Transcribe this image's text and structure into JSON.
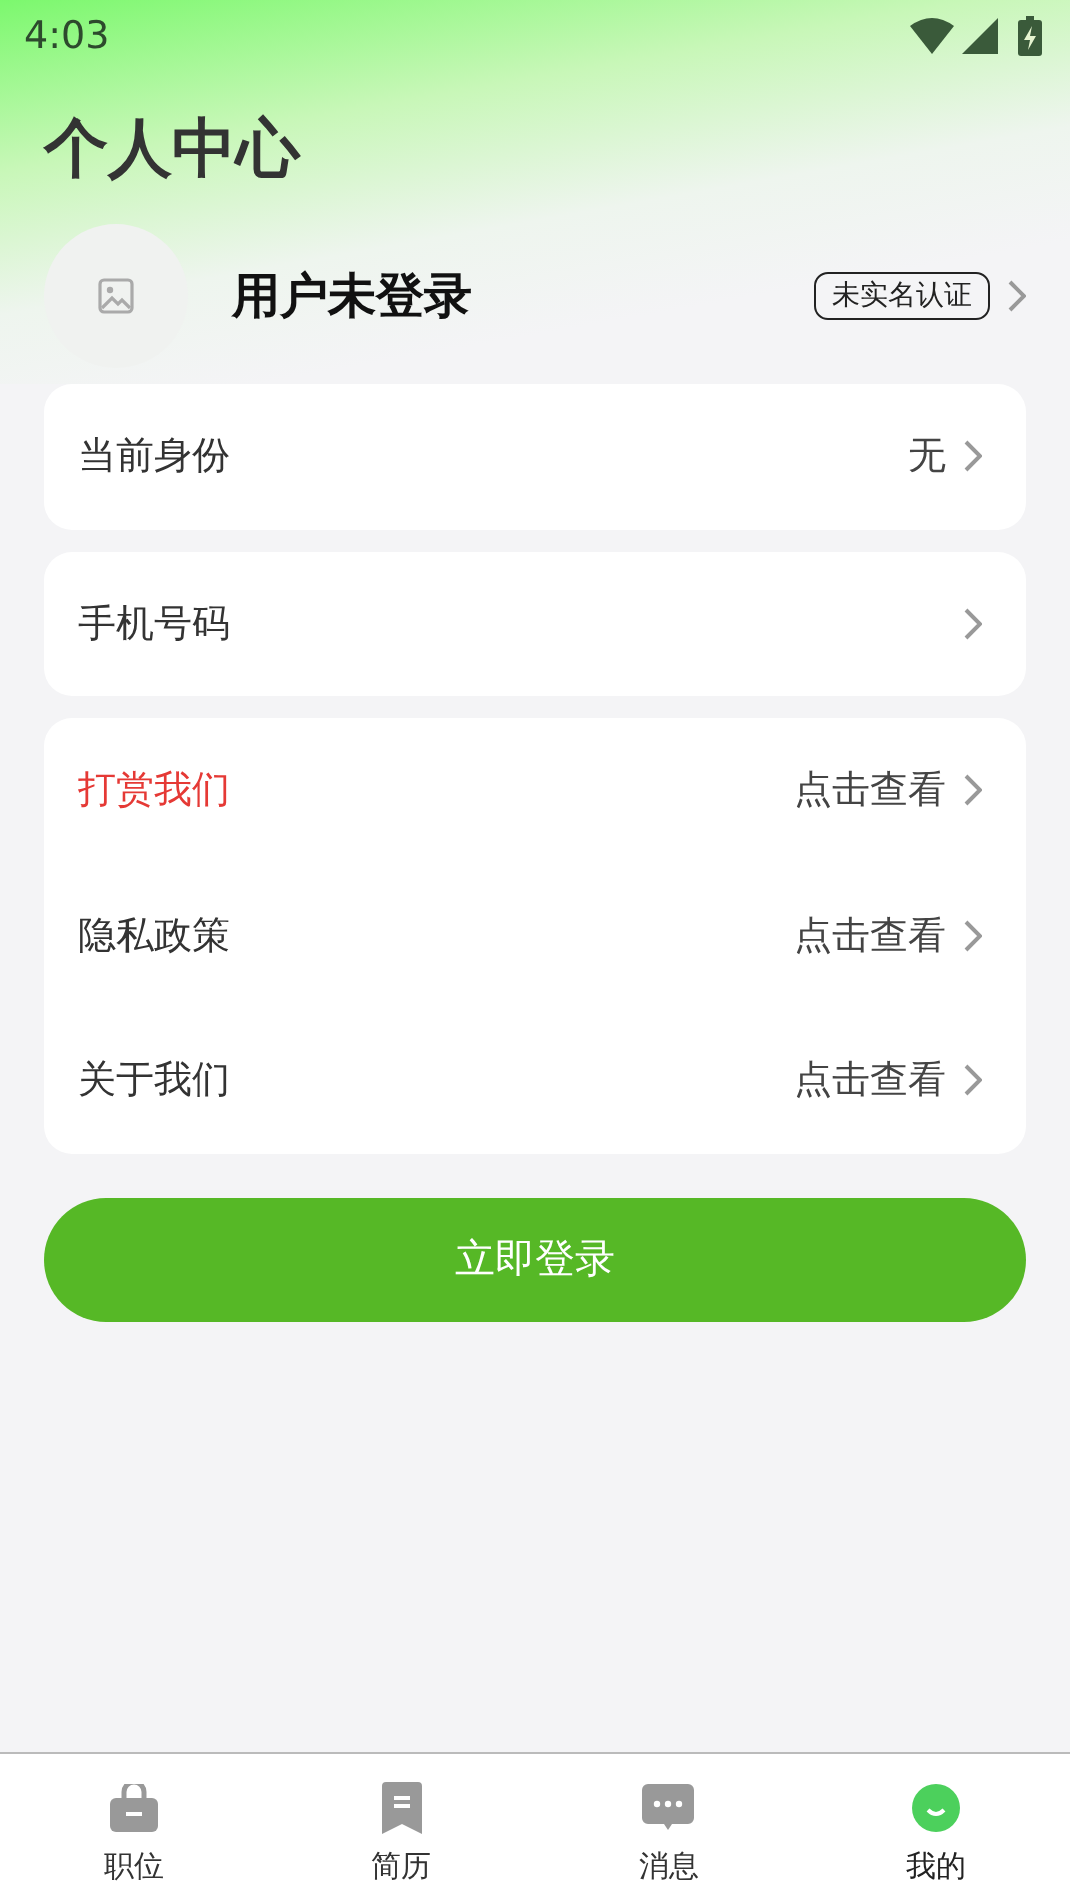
{
  "status_bar": {
    "time": "4:03"
  },
  "title": "个人中心",
  "profile": {
    "name": "用户未登录",
    "badge": "未实名认证"
  },
  "cards": [
    {
      "rows": [
        {
          "label": "当前身份",
          "value": "无",
          "color": "#333333"
        }
      ]
    },
    {
      "rows": [
        {
          "label": "手机号码",
          "color": "#333333"
        }
      ]
    },
    {
      "rows": [
        {
          "label": "打赏我们",
          "value": "点击查看",
          "color": "#e53935"
        },
        {
          "label": "隐私政策",
          "value": "点击查看",
          "color": "#333333"
        },
        {
          "label": "关于我们",
          "value": "点击查看",
          "color": "#333333"
        }
      ]
    }
  ],
  "login_button": "立即登录",
  "tabs": [
    {
      "label": "职位",
      "kind": "briefcase",
      "selected": false
    },
    {
      "label": "简历",
      "kind": "bookmark",
      "selected": false
    },
    {
      "label": "消息",
      "kind": "chat",
      "selected": false
    },
    {
      "label": "我的",
      "kind": "smile",
      "selected": true
    }
  ]
}
